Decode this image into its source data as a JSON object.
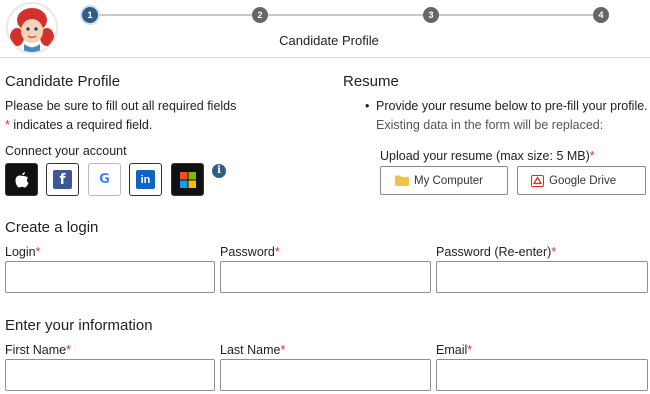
{
  "header": {
    "steps": [
      "1",
      "2",
      "3",
      "4"
    ],
    "active_step": 1,
    "title": "Candidate Profile"
  },
  "profile": {
    "heading": "Candidate Profile",
    "instructions": "Please be sure to fill out all required fields",
    "required_mark": "*",
    "required_note": " indicates a required field.",
    "connect_label": "Connect your account",
    "providers": [
      "Apple",
      "Facebook",
      "Google",
      "LinkedIn",
      "Microsoft"
    ]
  },
  "resume": {
    "heading": "Resume",
    "bullet": "Provide your resume below to pre-fill your profile.",
    "warning": "Existing data in the form will be replaced:",
    "upload_label": "Upload your resume (max size: 5 MB)",
    "required_mark": "*",
    "computer_button": "My Computer",
    "drive_button": "Google Drive"
  },
  "login": {
    "heading": "Create a login",
    "fields": [
      {
        "label": "Login",
        "required": "*",
        "value": ""
      },
      {
        "label": "Password",
        "required": "*",
        "value": ""
      },
      {
        "label": "Password (Re-enter)",
        "required": "*",
        "value": ""
      }
    ]
  },
  "info": {
    "heading": "Enter your information",
    "fields": [
      {
        "label": "First Name",
        "required": "*",
        "value": ""
      },
      {
        "label": "Last Name",
        "required": "*",
        "value": ""
      },
      {
        "label": "Email",
        "required": "*",
        "value": ""
      }
    ]
  },
  "colors": {
    "accent": "#2f5f86",
    "required": "#d0342c",
    "facebook": "#3b5998",
    "linkedin": "#0a66c2"
  }
}
